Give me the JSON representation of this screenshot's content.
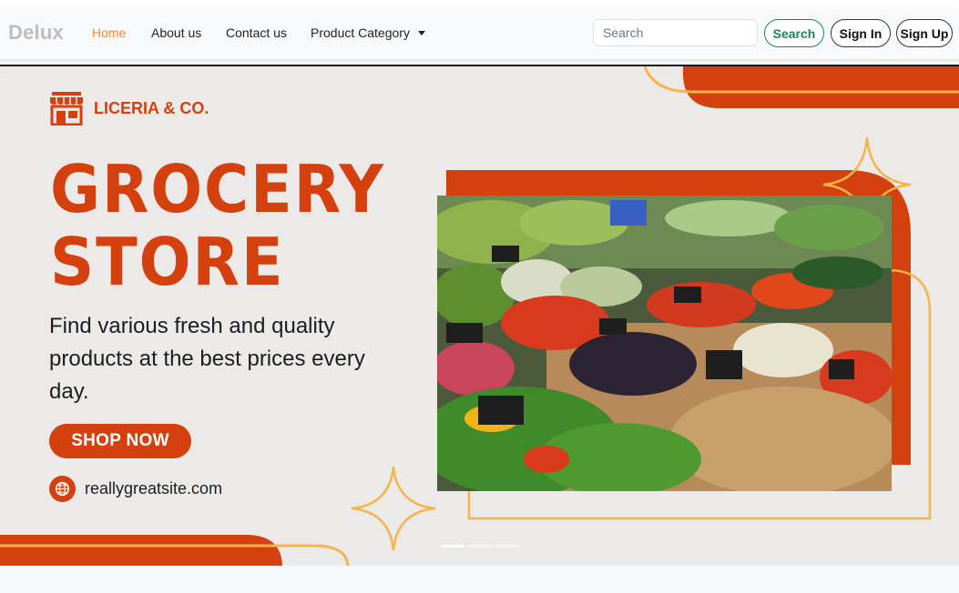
{
  "navbar": {
    "brand": "Delux",
    "links": [
      {
        "label": "Home",
        "active": true
      },
      {
        "label": "About us",
        "active": false
      },
      {
        "label": "Contact us",
        "active": false
      },
      {
        "label": "Product Category",
        "active": false,
        "dropdown": true
      }
    ],
    "search_placeholder": "Search",
    "search_button": "Search",
    "signin_button": "Sign In",
    "signup_button": "Sign Up"
  },
  "hero": {
    "company": "LICERIA & CO.",
    "title_line1": "GROCERY",
    "title_line2": "STORE",
    "tagline": "Find various fresh and quality products at the best prices every day.",
    "cta": "SHOP NOW",
    "website": "reallygreatsite.com",
    "slides": 3,
    "active_slide": 1
  },
  "icons": [
    "store-icon",
    "globe-icon",
    "sparkle-icon",
    "caret-down-icon"
  ],
  "colors": {
    "accent": "#d4410f",
    "gold": "#f6b54c",
    "home_link": "#f28a3c",
    "search_green": "#198754",
    "hero_bg": "#eceae9"
  }
}
